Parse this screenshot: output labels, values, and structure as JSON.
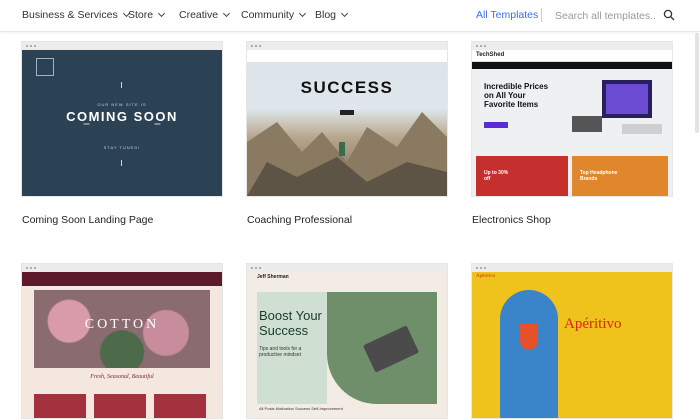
{
  "nav": {
    "items": [
      {
        "label": "Business & Services"
      },
      {
        "label": "Store"
      },
      {
        "label": "Creative"
      },
      {
        "label": "Community"
      },
      {
        "label": "Blog"
      }
    ],
    "all_templates": "All Templates",
    "search_placeholder": "Search all templates...",
    "search_icon": "search-icon"
  },
  "templates": [
    {
      "title": "Coming Soon Landing Page",
      "preview": {
        "tagline": "OUR NEW SITE IS",
        "headline": "COMING SOON",
        "footer": "STAY TUNED!"
      }
    },
    {
      "title": "Coaching Professional",
      "preview": {
        "headline": "SUCCESS"
      }
    },
    {
      "title": "Electronics Shop",
      "preview": {
        "brand": "TechShed",
        "headline": "Incredible Prices on All Your Favorite Items",
        "promo_left": "Up to 30% off",
        "promo_right": "Top Headphone Brands"
      }
    },
    {
      "title": "",
      "preview": {
        "headline": "COTTON",
        "subheadline": "Fresh, Seasonal, Beautiful"
      }
    },
    {
      "title": "",
      "preview": {
        "name": "Jeff Sherman",
        "headline": "Boost Your Success",
        "subheadline": "Tips and tools for a productive mindset",
        "footer": "All Posts   Motivation   Success   Self-Improvement"
      }
    },
    {
      "title": "",
      "preview": {
        "brand": "Apéritivo",
        "headline": "Apéritivo"
      }
    }
  ],
  "colors": {
    "accent": "#3b6df0",
    "coming_soon_bg": "#2b4255",
    "electronics_button": "#5b2cd6",
    "cotton_header": "#5d1a2a",
    "aperitivo_bg": "#f0c21c",
    "aperitivo_text": "#d9281e"
  }
}
